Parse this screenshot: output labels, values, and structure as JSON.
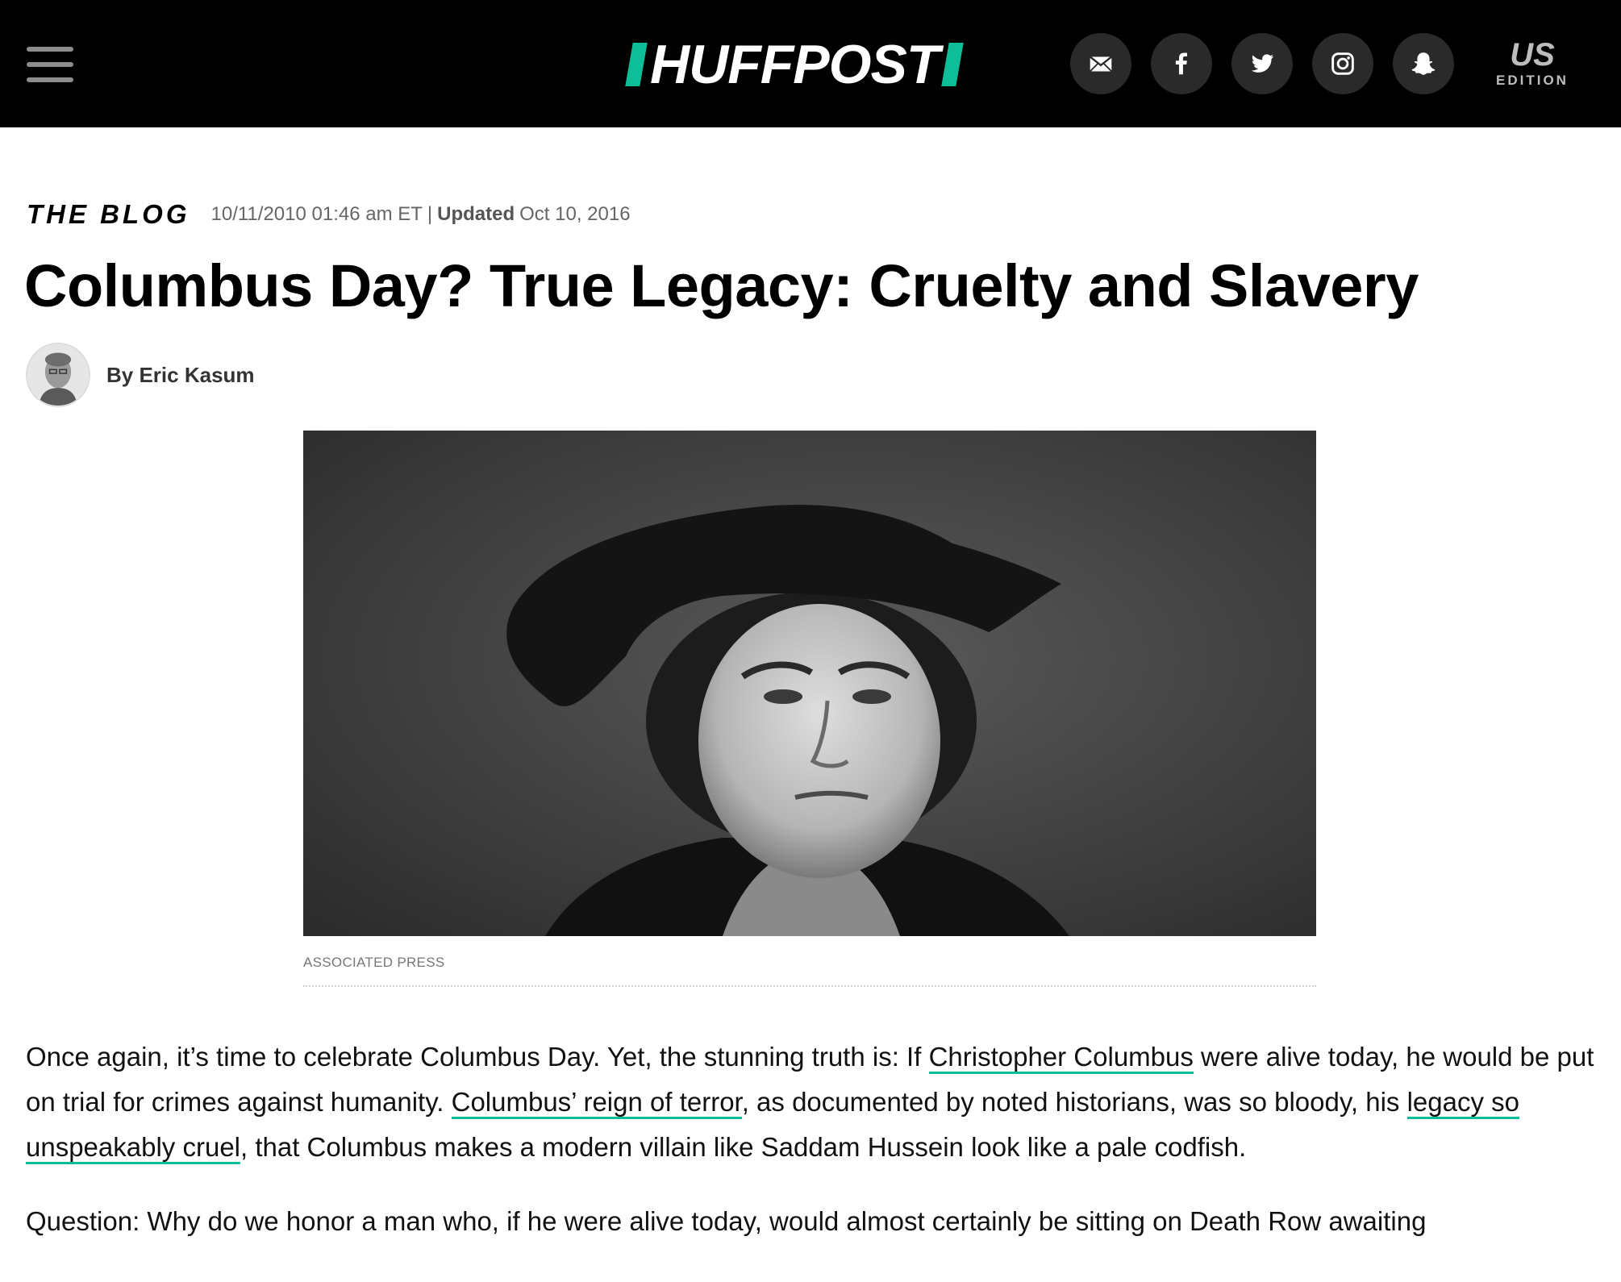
{
  "header": {
    "logo": "HUFFPOST",
    "edition_top": "US",
    "edition_bottom": "EDITION",
    "social_icons": [
      "email-icon",
      "facebook-icon",
      "twitter-icon",
      "instagram-icon",
      "snapchat-icon"
    ]
  },
  "article": {
    "section": "THE BLOG",
    "date": "10/11/2010 01:46 am ET",
    "separator": "|",
    "updated_label": "Updated",
    "updated_date": "Oct 10, 2016",
    "title": "Columbus Day? True Legacy: Cruelty and Slavery",
    "byline": "By Eric Kasum",
    "image_credit": "ASSOCIATED PRESS",
    "p1": {
      "t1": "Once again, it’s time to celebrate Columbus Day. Yet, the stunning truth is: If ",
      "link1": "Christopher Columbus",
      "t2": " were alive today, he would be put on trial for crimes against humanity. ",
      "link2": "Columbus’ reign of terror",
      "t3": ", as documented by noted historians, was so bloody, his ",
      "link3": "legacy so unspeakably cruel",
      "t4": ", that Columbus makes a modern villain like Saddam Hussein look like a pale codfish."
    },
    "p2": "Question: Why do we honor a man who, if he were alive today, would almost certainly be sitting on Death Row awaiting"
  },
  "colors": {
    "brand": "#0dbe98",
    "topbar": "#000000",
    "icon_bg": "#2a2a2a"
  }
}
